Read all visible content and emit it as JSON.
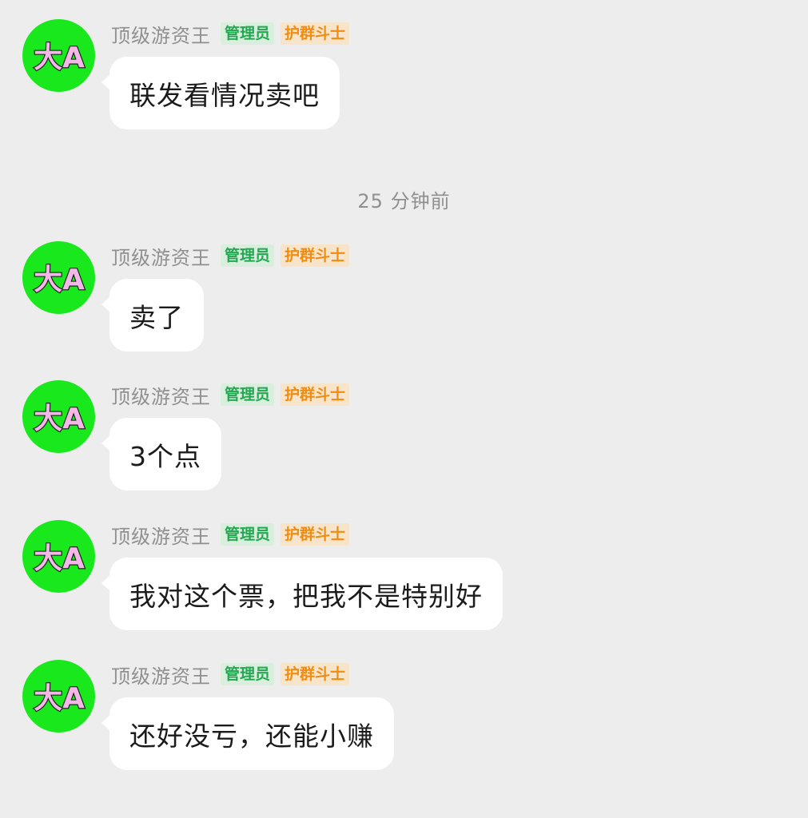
{
  "chat": {
    "timestamp": "25 分钟前",
    "avatar_text": "大A",
    "colors": {
      "avatar_bg": "#19e81d",
      "avatar_text_fill": "#f3b8e8",
      "admin_badge_text": "#21a851",
      "admin_badge_bg": "#d9eedd",
      "fighter_badge_text": "#f08c12",
      "fighter_badge_bg": "#f7e4c9",
      "page_bg": "#ededed"
    },
    "messages": [
      {
        "sender": "顶级游资王",
        "badges": [
          "管理员",
          "护群斗士"
        ],
        "text": "联发看情况卖吧"
      },
      {
        "sender": "顶级游资王",
        "badges": [
          "管理员",
          "护群斗士"
        ],
        "text": "卖了"
      },
      {
        "sender": "顶级游资王",
        "badges": [
          "管理员",
          "护群斗士"
        ],
        "text": "3个点"
      },
      {
        "sender": "顶级游资王",
        "badges": [
          "管理员",
          "护群斗士"
        ],
        "text": "我对这个票，把我不是特别好"
      },
      {
        "sender": "顶级游资王",
        "badges": [
          "管理员",
          "护群斗士"
        ],
        "text": "还好没亏，还能小赚"
      }
    ]
  }
}
